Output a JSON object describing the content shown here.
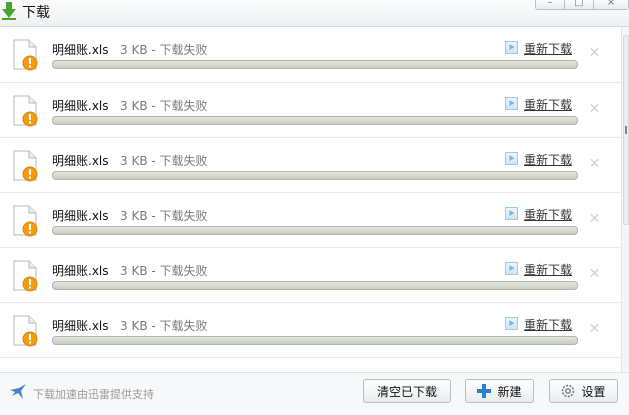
{
  "window": {
    "title": "下载",
    "controls": [
      "minimize",
      "maximize",
      "close"
    ]
  },
  "downloads": [
    {
      "name": "明细账.xls",
      "info": "3 KB - 下载失败",
      "action": "重新下载",
      "progress": 0
    },
    {
      "name": "明细账.xls",
      "info": "3 KB - 下载失败",
      "action": "重新下载",
      "progress": 0
    },
    {
      "name": "明细账.xls",
      "info": "3 KB - 下载失败",
      "action": "重新下载",
      "progress": 0
    },
    {
      "name": "明细账.xls",
      "info": "3 KB - 下载失败",
      "action": "重新下载",
      "progress": 0
    },
    {
      "name": "明细账.xls",
      "info": "3 KB - 下载失败",
      "action": "重新下载",
      "progress": 0
    },
    {
      "name": "明细账.xls",
      "info": "3 KB - 下载失败",
      "action": "重新下载",
      "progress": 0
    }
  ],
  "footer": {
    "note": "下载加速由迅雷提供支持",
    "clear_label": "清空已下载",
    "new_label": "新建",
    "settings_label": "设置"
  },
  "icons": {
    "title": "download-arrow-icon",
    "file": "file-warning-icon",
    "retry": "play-icon",
    "remove": "close-icon",
    "footer": "thunder-bird-icon",
    "new": "plus-icon",
    "settings": "gear-icon"
  },
  "colors": {
    "warning": "#f39c12",
    "accent": "#2f7fd1",
    "progress_fill": "#c9cdc2"
  }
}
